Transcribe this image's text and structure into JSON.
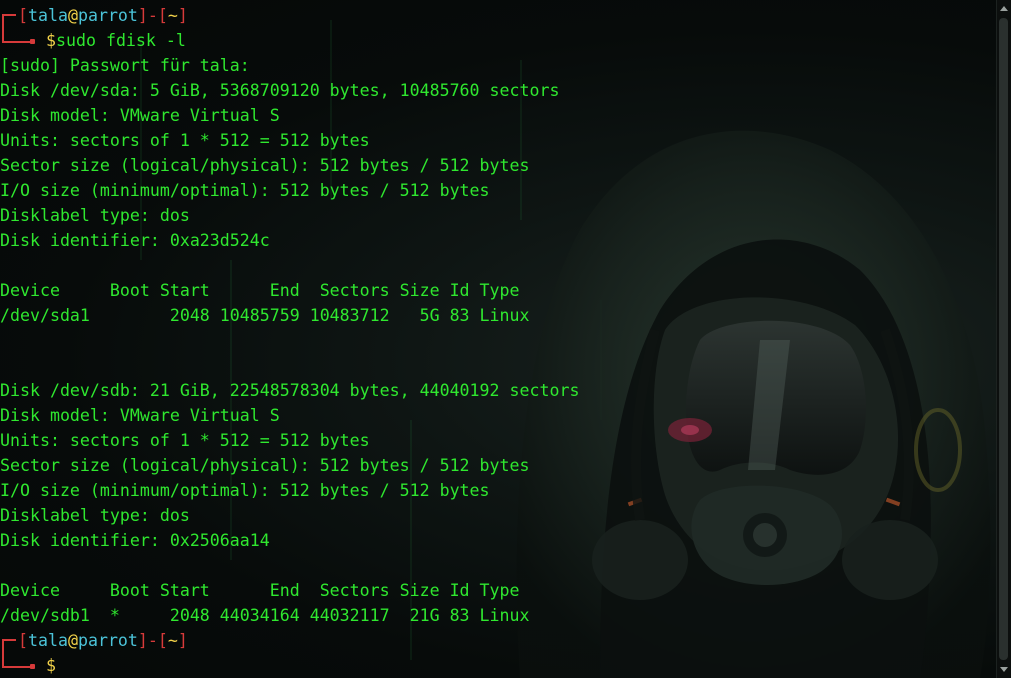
{
  "prompt": {
    "user": "tala",
    "at": "@",
    "host": "parrot",
    "dir": "~",
    "dollar": "$"
  },
  "command": "sudo fdisk -l",
  "output_lines": [
    "[sudo] Passwort für tala:",
    "Disk /dev/sda: 5 GiB, 5368709120 bytes, 10485760 sectors",
    "Disk model: VMware Virtual S",
    "Units: sectors of 1 * 512 = 512 bytes",
    "Sector size (logical/physical): 512 bytes / 512 bytes",
    "I/O size (minimum/optimal): 512 bytes / 512 bytes",
    "Disklabel type: dos",
    "Disk identifier: 0xa23d524c",
    "",
    "Device     Boot Start      End  Sectors Size Id Type",
    "/dev/sda1        2048 10485759 10483712   5G 83 Linux",
    "",
    "",
    "Disk /dev/sdb: 21 GiB, 22548578304 bytes, 44040192 sectors",
    "Disk model: VMware Virtual S",
    "Units: sectors of 1 * 512 = 512 bytes",
    "Sector size (logical/physical): 512 bytes / 512 bytes",
    "I/O size (minimum/optimal): 512 bytes / 512 bytes",
    "Disklabel type: dos",
    "Disk identifier: 0x2506aa14",
    "",
    "Device     Boot Start      End  Sectors Size Id Type",
    "/dev/sdb1  *     2048 44034164 44032117  21G 83 Linux"
  ],
  "colors": {
    "text": "#2fe82f",
    "bracket": "#d63a3a",
    "user": "#4bc3d8",
    "accent": "#f2d24a",
    "background": "#050807"
  },
  "icons": {
    "background": "hooded-gas-mask-figure-wallpaper"
  }
}
